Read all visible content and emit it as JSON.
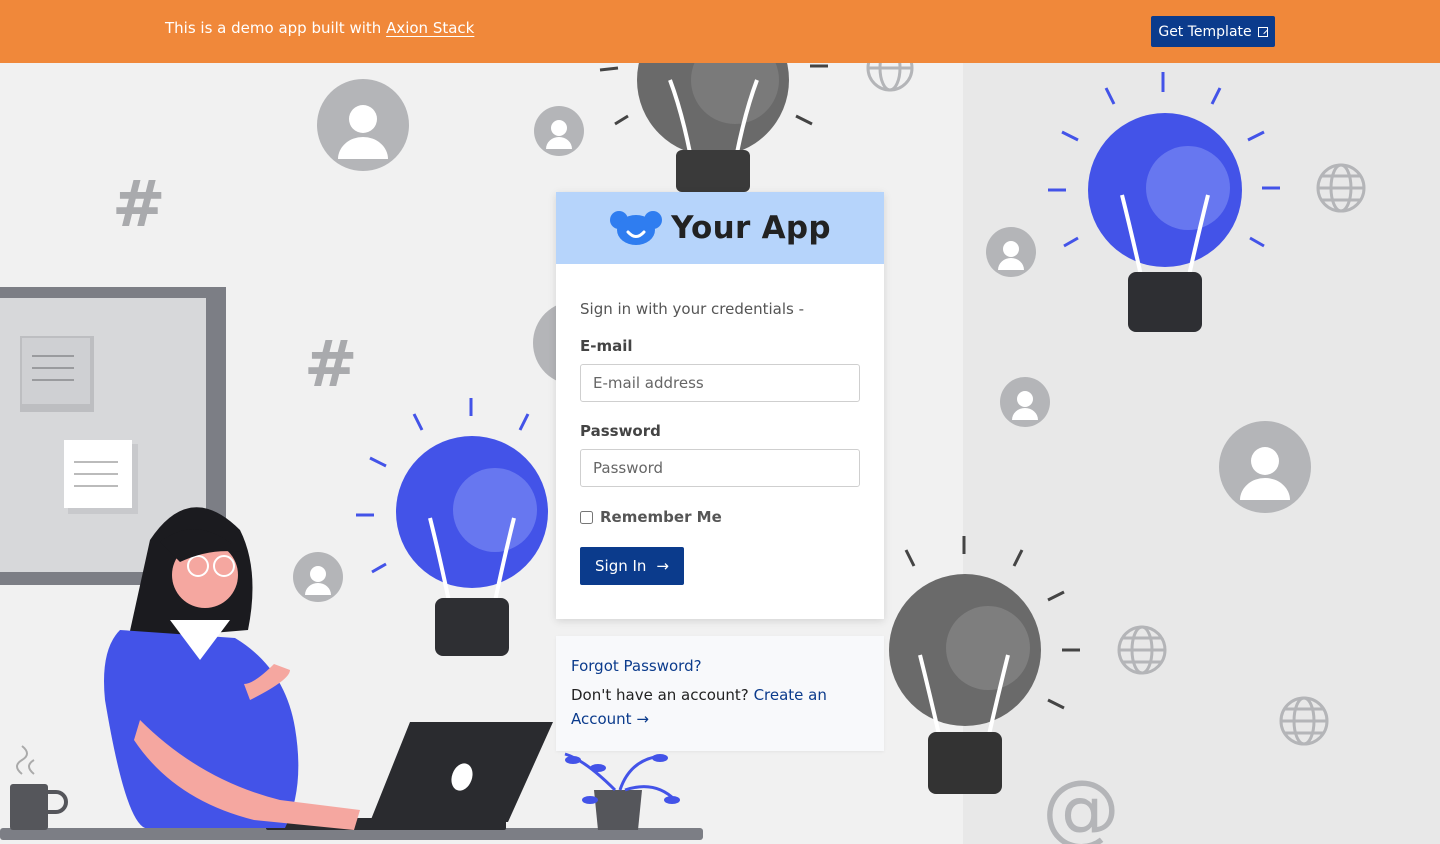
{
  "banner": {
    "text": "This is a demo app built with",
    "link": "Axion Stack",
    "button": "Get Template",
    "button_icon": "external-link-icon"
  },
  "login": {
    "app_name": "Your App",
    "logo_icon": "bear-face-logo-icon",
    "subtitle": "Sign in with your credentials -",
    "email_label": "E-mail",
    "email_placeholder": "E-mail address",
    "email_value": "",
    "password_label": "Password",
    "password_placeholder": "Password",
    "password_value": "",
    "remember_label": "Remember Me",
    "remember_checked": false,
    "submit": "Sign In",
    "submit_icon": "arrow-right-icon"
  },
  "links": {
    "forgot": "Forgot Password?",
    "no_account": "Don't have an account?",
    "create_part1": "Create an",
    "create_part2": "Account",
    "create_icon": "arrow-right-icon"
  },
  "colors": {
    "banner": "#f0883a",
    "primary": "#0b3b8c",
    "header": "#b6d4fb",
    "bulb_blue": "#4353e8",
    "bulb_gray": "#6a6a6a",
    "illustration_gray": "#b4b5b8"
  }
}
